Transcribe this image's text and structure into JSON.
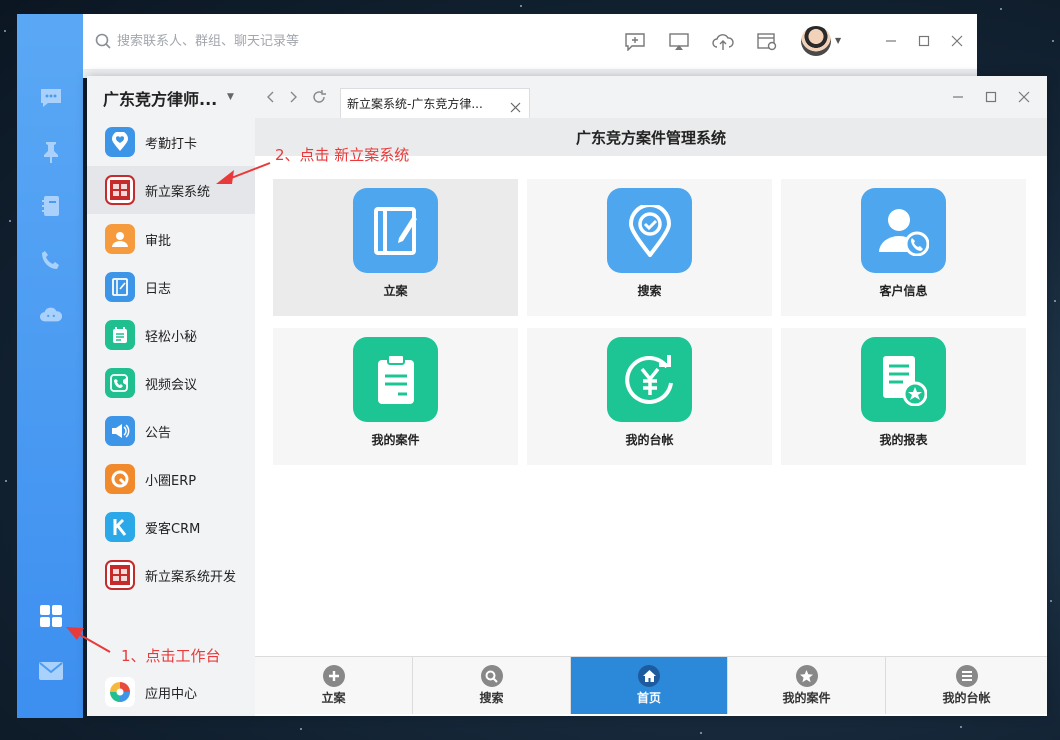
{
  "im_client": {
    "search_placeholder": "搜索联系人、群组、聊天记录等"
  },
  "workspace": {
    "org_name": "广东竞方律师...",
    "apps": [
      {
        "label": "考勤打卡",
        "color": "#3d95e8",
        "icon": "location-heart-icon"
      },
      {
        "label": "新立案系统",
        "color": "#c62b2b",
        "icon": "seal-icon"
      },
      {
        "label": "审批",
        "color": "#f59a3d",
        "icon": "person-icon"
      },
      {
        "label": "日志",
        "color": "#3d95e8",
        "icon": "notebook-icon"
      },
      {
        "label": "轻松小秘",
        "color": "#1fbf8f",
        "icon": "calendar-icon"
      },
      {
        "label": "视频会议",
        "color": "#1fbf8f",
        "icon": "video-phone-icon"
      },
      {
        "label": "公告",
        "color": "#3d95e8",
        "icon": "speaker-icon"
      },
      {
        "label": "小圈ERP",
        "color": "#f08a2c",
        "icon": "erp-logo-icon"
      },
      {
        "label": "爱客CRM",
        "color": "#2aa8e8",
        "icon": "crm-logo-icon"
      },
      {
        "label": "新立案系统开发",
        "color": "#c62b2b",
        "icon": "seal-icon"
      }
    ],
    "app_center_label": "应用中心"
  },
  "browser": {
    "tab_title": "新立案系统-广东竞方律..."
  },
  "case_system": {
    "title": "广东竞方案件管理系统",
    "tiles": [
      {
        "label": "立案",
        "color": "#4ea7ee",
        "icon": "register-case-icon"
      },
      {
        "label": "搜索",
        "color": "#4ea7ee",
        "icon": "search-pin-icon"
      },
      {
        "label": "客户信息",
        "color": "#4ea7ee",
        "icon": "client-phone-icon"
      },
      {
        "label": "我的案件",
        "color": "#1dc494",
        "icon": "clipboard-icon"
      },
      {
        "label": "我的台帐",
        "color": "#1dc494",
        "icon": "yuan-refresh-icon"
      },
      {
        "label": "我的报表",
        "color": "#1dc494",
        "icon": "report-star-icon"
      }
    ],
    "bottom_nav": [
      {
        "label": "立案",
        "icon": "plus-icon"
      },
      {
        "label": "搜索",
        "icon": "search-icon"
      },
      {
        "label": "首页",
        "icon": "home-icon",
        "active": true
      },
      {
        "label": "我的案件",
        "icon": "star-icon"
      },
      {
        "label": "我的台帐",
        "icon": "menu-icon"
      }
    ]
  },
  "annotations": {
    "step1": "1、点击工作台",
    "step2": "2、点击 新立案系统"
  },
  "colors": {
    "rail": "#4a9bf2",
    "annotation": "#e83a3a",
    "active_nav": "#2c88d9"
  }
}
